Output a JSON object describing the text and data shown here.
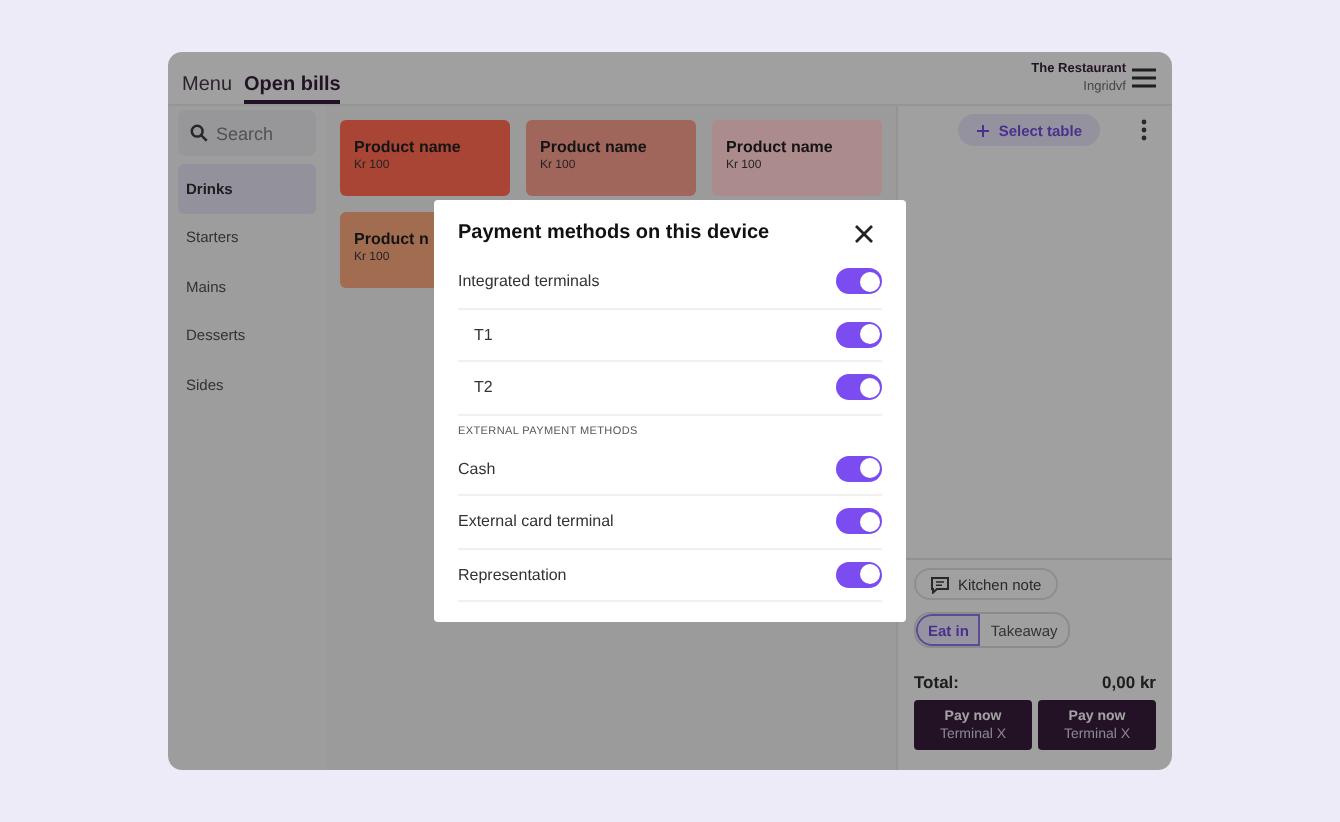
{
  "header": {
    "tabs": [
      {
        "label": "Menu",
        "selected": false
      },
      {
        "label": "Open bills",
        "selected": true
      }
    ],
    "restaurant": "The Restaurant",
    "user": "Ingridvf"
  },
  "sidebar": {
    "search": {
      "placeholder": "Search"
    },
    "categories": [
      {
        "label": "Drinks",
        "selected": true
      },
      {
        "label": "Starters",
        "selected": false
      },
      {
        "label": "Mains",
        "selected": false
      },
      {
        "label": "Desserts",
        "selected": false
      },
      {
        "label": "Sides",
        "selected": false
      }
    ]
  },
  "products": [
    {
      "name": "Product name",
      "price": "Kr 100",
      "color": "#a84535"
    },
    {
      "name": "Product name",
      "price": "Kr 100",
      "color": "#a0665c"
    },
    {
      "name": "Product name",
      "price": "Kr 100",
      "color": "#ab8b8b"
    },
    {
      "name": "Product n",
      "price": "Kr 100",
      "color": "#a26c50"
    }
  ],
  "order": {
    "select_table": "Select table",
    "kitchen_note": "Kitchen note",
    "modes": [
      {
        "label": "Eat in",
        "selected": true
      },
      {
        "label": "Takeaway",
        "selected": false
      }
    ],
    "total_label": "Total:",
    "total": "0,00 kr",
    "pay_buttons": [
      {
        "label": "Pay now",
        "terminal": "Terminal X"
      },
      {
        "label": "Pay now",
        "terminal": "Terminal X"
      }
    ]
  },
  "dialog": {
    "title": "Payment methods on this device",
    "items": [
      {
        "kind": "toggle",
        "label": "Integrated terminals",
        "on": true,
        "children": [
          {
            "kind": "toggle",
            "label": "T1",
            "on": true
          },
          {
            "kind": "toggle",
            "label": "T2",
            "on": true
          }
        ]
      },
      {
        "kind": "heading",
        "label": "EXTERNAL PAYMENT METHODS"
      },
      {
        "kind": "toggle",
        "label": "Cash",
        "on": true
      },
      {
        "kind": "toggle",
        "label": "External card terminal",
        "on": true
      },
      {
        "kind": "toggle",
        "label": "Representation",
        "on": true
      }
    ]
  }
}
